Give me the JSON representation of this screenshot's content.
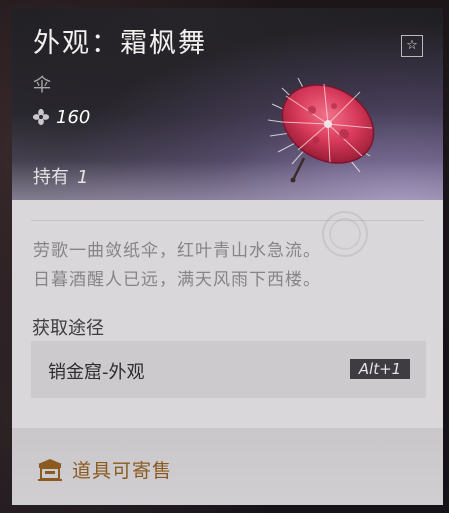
{
  "item": {
    "title": "外观：霜枫舞",
    "subtype": "伞",
    "price": "160",
    "owned_label": "持有",
    "owned_count": "1"
  },
  "description": {
    "line1": "劳歌一曲敛纸伞，红叶青山水急流。",
    "line2": "日暮酒醒人已远，满天风雨下西楼。"
  },
  "source": {
    "section_label": "获取途径",
    "entry_label": "销金窟-外观",
    "hotkey": "Alt+1"
  },
  "footer": {
    "tradable_label": "道具可寄售"
  },
  "icons": {
    "favorite": "star-outline-icon",
    "currency": "flower-currency-icon",
    "shop": "shop-stall-icon",
    "item_image": "red-paper-umbrella"
  },
  "colors": {
    "accent_gold": "#8b5a20",
    "umbrella_red": "#d83a5a",
    "hotkey_bg": "#3e3c40"
  }
}
